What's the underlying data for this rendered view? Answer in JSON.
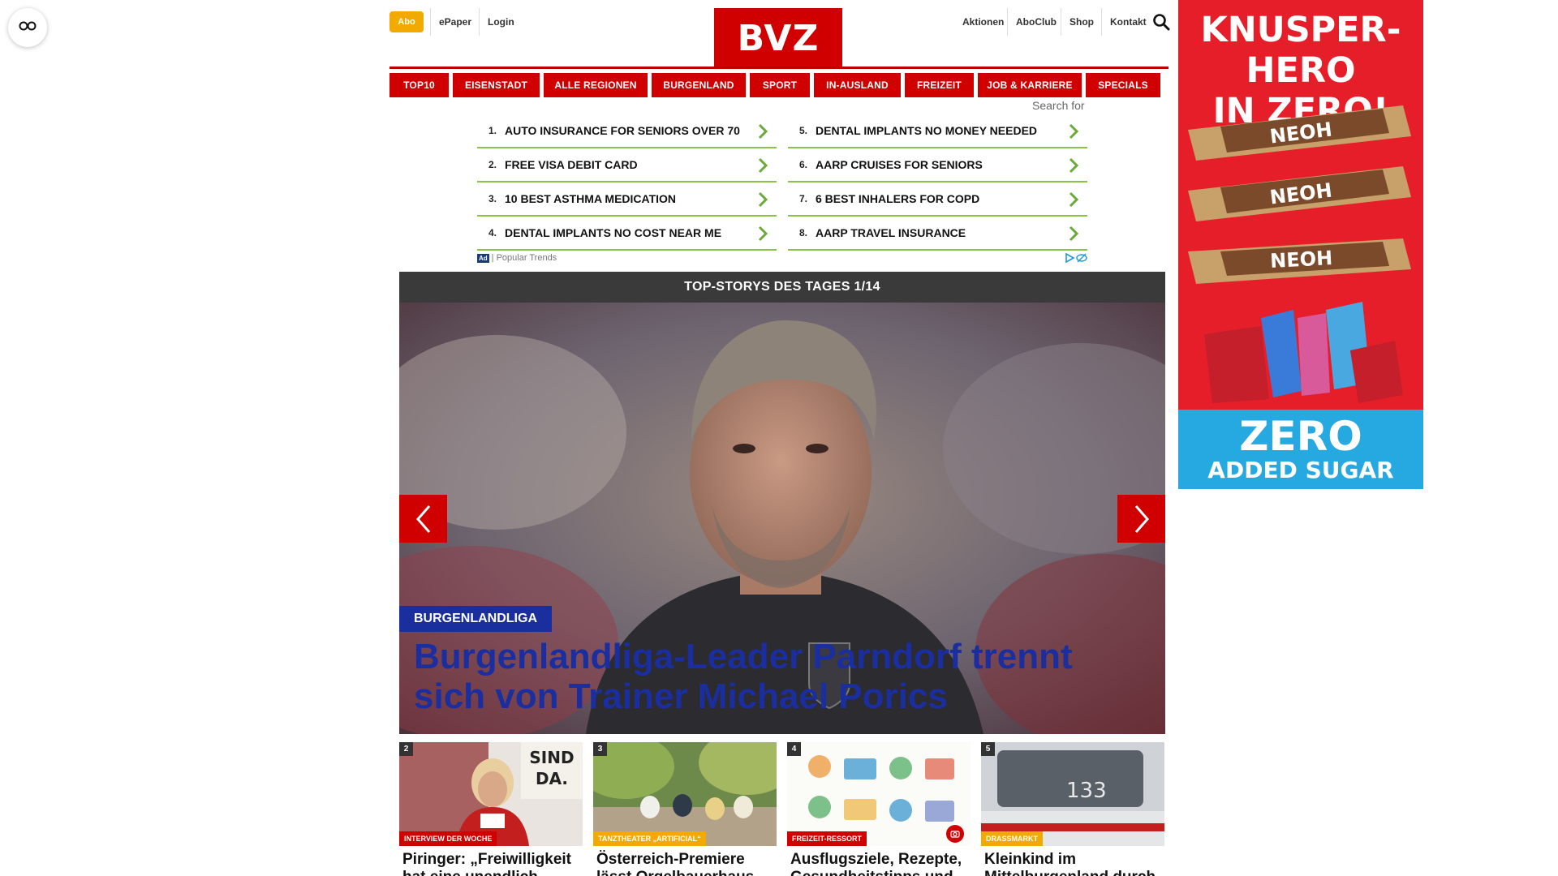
{
  "header": {
    "abo_label": "Abo",
    "epaper_label": "ePaper",
    "login_label": "Login",
    "logo_text": "BVZ",
    "right_links": [
      "Aktionen",
      "AboClub",
      "Shop",
      "Kontakt"
    ]
  },
  "nav": {
    "items": [
      "TOP10",
      "EISENSTADT",
      "ALLE REGIONEN",
      "BURGENLAND",
      "SPORT",
      "IN-AUSLAND",
      "FREIZEIT",
      "JOB & KARRIERE",
      "SPECIALS"
    ]
  },
  "ad_block": {
    "search_for": "Search for",
    "links": [
      {
        "num": "1.",
        "text": "AUTO INSURANCE FOR SENIORS OVER 70"
      },
      {
        "num": "5.",
        "text": "DENTAL IMPLANTS NO MONEY NEEDED"
      },
      {
        "num": "2.",
        "text": "FREE VISA DEBIT CARD"
      },
      {
        "num": "6.",
        "text": "AARP CRUISES FOR SENIORS"
      },
      {
        "num": "3.",
        "text": "10 BEST ASTHMA MEDICATION"
      },
      {
        "num": "7.",
        "text": "6 BEST INHALERS FOR COPD"
      },
      {
        "num": "4.",
        "text": "DENTAL IMPLANTS NO COST NEAR ME"
      },
      {
        "num": "8.",
        "text": "AARP TRAVEL INSURANCE"
      }
    ],
    "ad_badge": "Ad",
    "footer_text": "| Popular Trends"
  },
  "top_stories": {
    "bar_title": "TOP-STORYS DES TAGES 1/14",
    "hero_tag": "BURGENLANDLIGA",
    "hero_title": "Burgenlandliga-Leader Parndorf trennt sich von Trainer Michael Porics"
  },
  "cards": [
    {
      "num": "2",
      "tag": "INTERVIEW DER WOCHE",
      "tag_color": "#d00000",
      "title": "Piringer: „Freiwilligkeit hat eine unendlich große"
    },
    {
      "num": "3",
      "tag": "TANZTHEATER „ARTIFICIAL“",
      "tag_color": "#f2a900",
      "title": "Österreich-Premiere lässt Orgelbauerhaus"
    },
    {
      "num": "4",
      "tag": "FREIZEIT-RESSORT",
      "tag_color": "#d00000",
      "title": "Ausflugsziele, Rezepte, Gesundheitstipps und"
    },
    {
      "num": "5",
      "tag": "DRASSMARKT",
      "tag_color": "#f2a900",
      "title": "Kleinkind im Mittelburgenland durch"
    }
  ],
  "side_ad": {
    "headline_1": "KNUSPER-HERO",
    "headline_2": "IN ZERO!",
    "zero": "ZERO",
    "added_sugar": "ADDED SUGAR",
    "brand": "NEOH",
    "brand_color": "#e61e2a",
    "bottom_color": "#26a8e0"
  },
  "colors": {
    "brand_red": "#d00000",
    "abo_yellow": "#f2a900",
    "hero_blue": "#1a2ea0",
    "link_green": "#8bc34a"
  }
}
